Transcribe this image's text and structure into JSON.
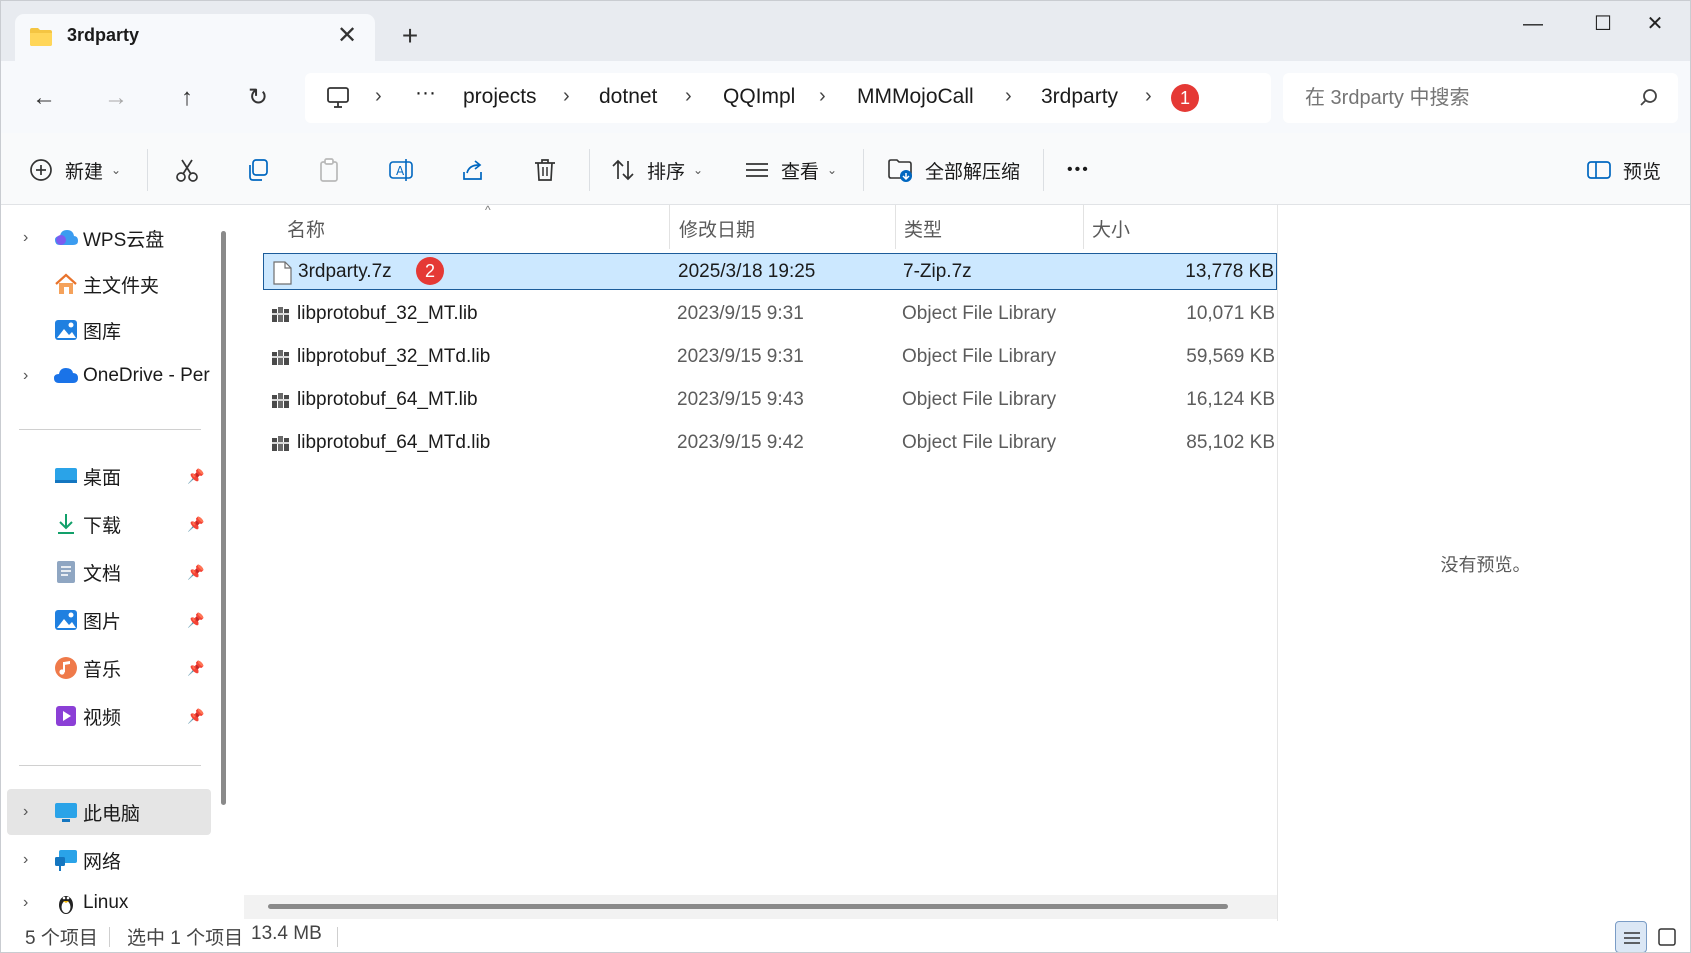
{
  "window": {
    "tab_title": "3rdparty",
    "new_tab_glyph": "+",
    "close_tab_glyph": "✕",
    "minimize_glyph": "—",
    "maximize_glyph": "☐",
    "close_glyph": "✕"
  },
  "nav": {
    "back_glyph": "←",
    "forward_glyph": "→",
    "up_glyph": "↑",
    "refresh_glyph": "↻"
  },
  "address": {
    "overflow_glyph": "···",
    "separator_glyph": "›",
    "crumbs": [
      "projects",
      "dotnet",
      "QQImpl",
      "MMMojoCall",
      "3rdparty"
    ],
    "badge_1": "1"
  },
  "search": {
    "placeholder": "在 3rdparty 中搜索"
  },
  "toolbar": {
    "new_label": "新建",
    "sort_label": "排序",
    "view_label": "查看",
    "extract_label": "全部解压缩",
    "more_glyph": "•••",
    "preview_label": "预览",
    "caret": "⌄"
  },
  "sidebar": {
    "items": [
      {
        "label": "WPS云盘",
        "icon": "cloud-icon"
      },
      {
        "label": "主文件夹",
        "icon": "home-icon"
      },
      {
        "label": "图库",
        "icon": "gallery-icon"
      },
      {
        "label": "OneDrive - Per",
        "icon": "onedrive-icon"
      },
      {
        "label": "桌面",
        "icon": "desktop-icon"
      },
      {
        "label": "下载",
        "icon": "download-icon"
      },
      {
        "label": "文档",
        "icon": "documents-icon"
      },
      {
        "label": "图片",
        "icon": "pictures-icon"
      },
      {
        "label": "音乐",
        "icon": "music-icon"
      },
      {
        "label": "视频",
        "icon": "video-icon"
      },
      {
        "label": "此电脑",
        "icon": "computer-icon"
      },
      {
        "label": "网络",
        "icon": "network-icon"
      },
      {
        "label": "Linux",
        "icon": "linux-icon"
      }
    ],
    "chevron": "›",
    "pin": "📌"
  },
  "filelist": {
    "columns": {
      "name": "名称",
      "date": "修改日期",
      "type": "类型",
      "size": "大小"
    },
    "sort_glyph": "^",
    "badge_2": "2",
    "rows": [
      {
        "name": "3rdparty.7z",
        "date": "2025/3/18 19:25",
        "type": "7-Zip.7z",
        "size": "13,778 KB"
      },
      {
        "name": "libprotobuf_32_MT.lib",
        "date": "2023/9/15 9:31",
        "type": "Object File Library",
        "size": "10,071 KB"
      },
      {
        "name": "libprotobuf_32_MTd.lib",
        "date": "2023/9/15 9:31",
        "type": "Object File Library",
        "size": "59,569 KB"
      },
      {
        "name": "libprotobuf_64_MT.lib",
        "date": "2023/9/15 9:43",
        "type": "Object File Library",
        "size": "16,124 KB"
      },
      {
        "name": "libprotobuf_64_MTd.lib",
        "date": "2023/9/15 9:42",
        "type": "Object File Library",
        "size": "85,102 KB"
      }
    ]
  },
  "preview": {
    "empty_text": "没有预览。"
  },
  "status": {
    "item_count": "5 个项目",
    "selection": "选中 1 个项目",
    "size": "13.4 MB"
  },
  "colors": {
    "selection_bg": "#cce8ff",
    "selection_border": "#1c5c9a",
    "badge": "#e53935",
    "accent": "#0067c0"
  }
}
